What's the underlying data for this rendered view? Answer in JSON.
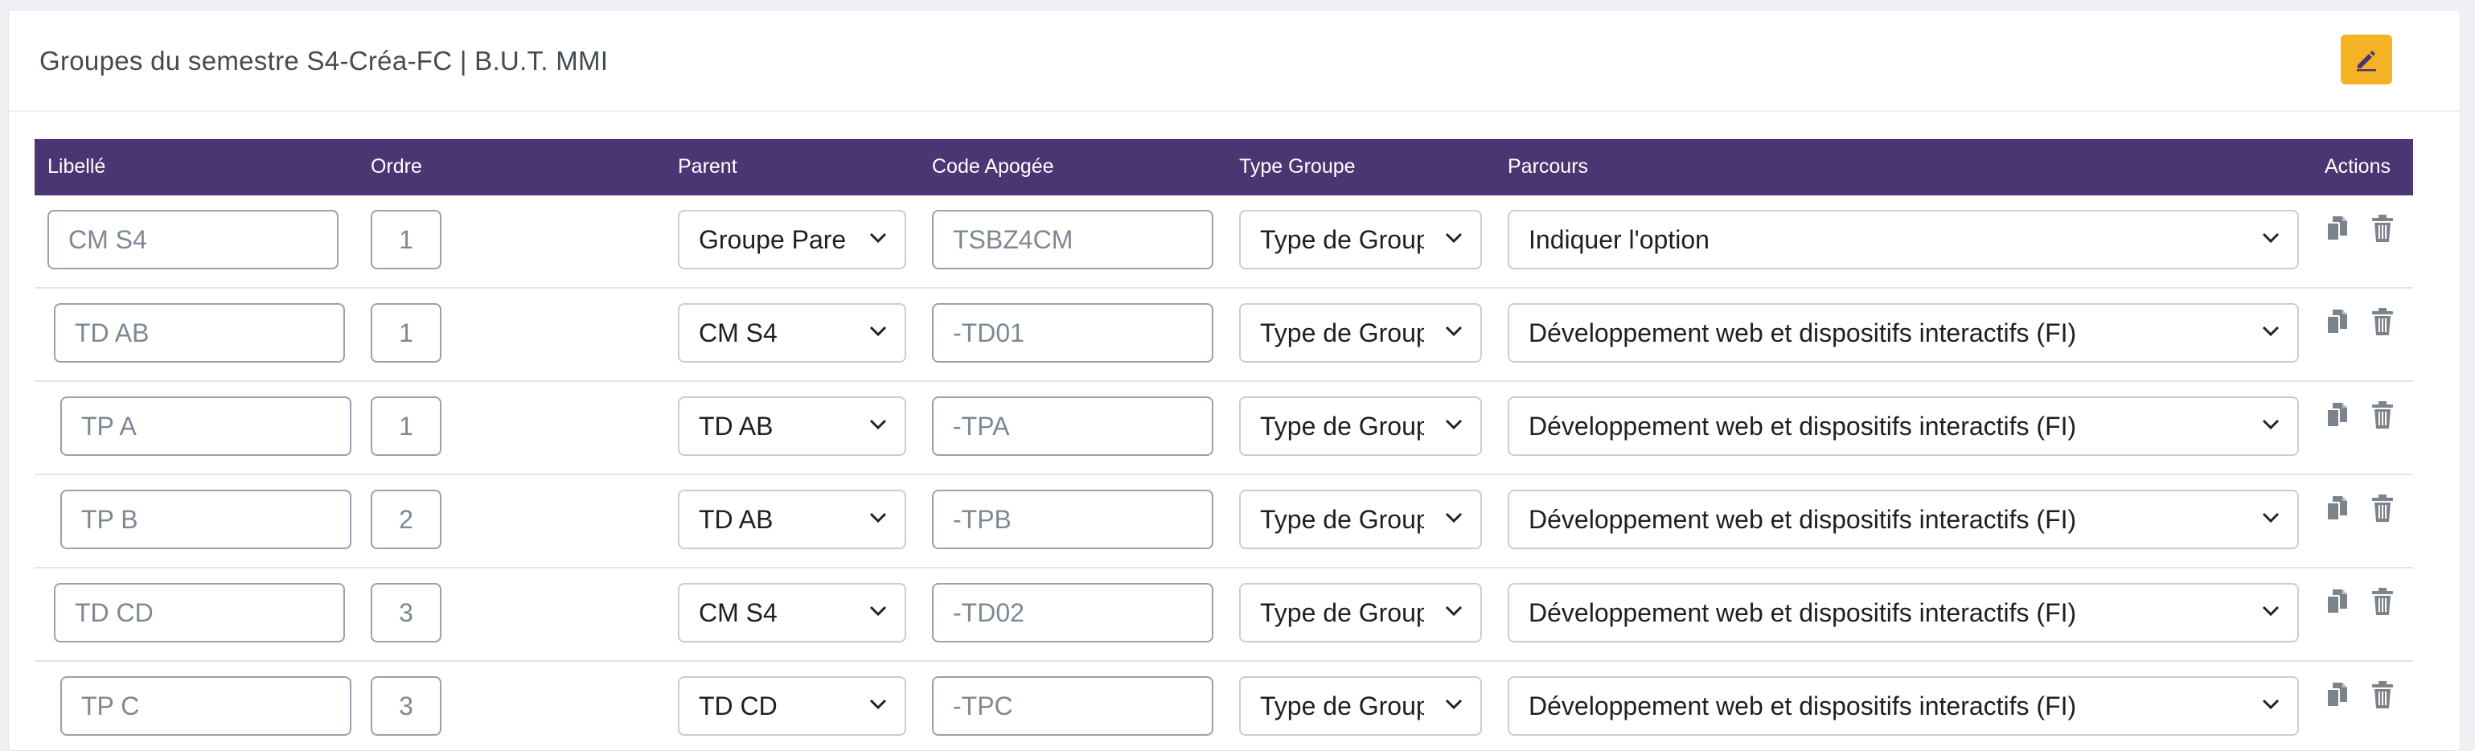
{
  "header": {
    "title": "Groupes du semestre S4-Créa-FC | B.U.T. MMI"
  },
  "columns": {
    "libelle": "Libellé",
    "ordre": "Ordre",
    "parent": "Parent",
    "code": "Code Apogée",
    "type": "Type Groupe",
    "parcours": "Parcours",
    "actions": "Actions"
  },
  "rows": [
    {
      "libelle": "CM S4",
      "ordre": "1",
      "parent": "Groupe Pare",
      "code": "TSBZ4CM",
      "type": "Type de Group",
      "parcours": "Indiquer l'option"
    },
    {
      "libelle": "TD AB",
      "ordre": "1",
      "parent": "CM S4",
      "code": "-TD01",
      "type": "Type de Group",
      "parcours": "Développement web et dispositifs interactifs (FI)"
    },
    {
      "libelle": "TP A",
      "ordre": "1",
      "parent": "TD AB",
      "code": "-TPA",
      "type": "Type de Group",
      "parcours": "Développement web et dispositifs interactifs (FI)"
    },
    {
      "libelle": "TP B",
      "ordre": "2",
      "parent": "TD AB",
      "code": "-TPB",
      "type": "Type de Group",
      "parcours": "Développement web et dispositifs interactifs (FI)"
    },
    {
      "libelle": "TD CD",
      "ordre": "3",
      "parent": "CM S4",
      "code": "-TD02",
      "type": "Type de Group",
      "parcours": "Développement web et dispositifs interactifs (FI)"
    },
    {
      "libelle": "TP C",
      "ordre": "3",
      "parent": "TD CD",
      "code": "-TPC",
      "type": "Type de Group",
      "parcours": "Développement web et dispositifs interactifs (FI)"
    }
  ],
  "icons": {
    "edit": "pencil-icon",
    "copy": "copy-icon",
    "delete": "trash-icon",
    "chevron": "chevron-down-icon"
  },
  "colors": {
    "header_bg": "#4b3572",
    "edit_button": "#f5b225",
    "icon_gray": "#7d838b"
  }
}
